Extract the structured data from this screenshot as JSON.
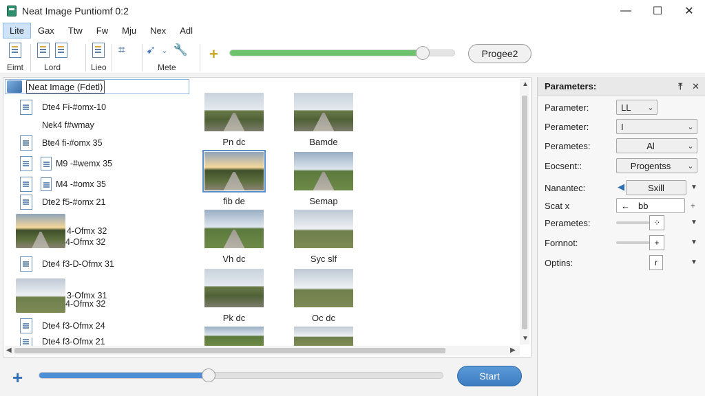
{
  "window": {
    "title": "Neat Image Puntiomf 0:2",
    "controls": [
      "—",
      "☐",
      "✕"
    ]
  },
  "menu": [
    "Lite",
    "Gax",
    "Ttw",
    "Fw",
    "Mju",
    "Nex",
    "Adl"
  ],
  "toolbar": {
    "groups": [
      {
        "label": "Eimt"
      },
      {
        "label": "Lord"
      },
      {
        "label": "Lieo"
      },
      {
        "label": "Mete"
      }
    ],
    "top_slider_fraction": 0.86,
    "progress_button": "Progee2"
  },
  "path": {
    "text": "Neat Image (Fdetl)"
  },
  "files": [
    {
      "name": "Dte4 Fi-#omx-10"
    },
    {
      "name": "Nek4 f#wmay"
    },
    {
      "name": "Bte4 fi-#omx 35"
    },
    {
      "name": "M9 -#wemx 35"
    },
    {
      "name": "M4 -#omx 35"
    },
    {
      "name": "Dte2 f5-#omx 21"
    },
    {
      "name": "4-Ofmx 32"
    },
    {
      "name": "4-Ofmx 32"
    },
    {
      "name": "Dte4 f3-D-Ofmx 31"
    },
    {
      "name": "3-Ofmx 31"
    },
    {
      "name": "4-Ofmx 32"
    },
    {
      "name": "Dte4 f3-Ofmx 24"
    },
    {
      "name": "Dte4 f3-Ofmx 21"
    }
  ],
  "thumbnails": [
    {
      "caption": "Pn dc"
    },
    {
      "caption": "Bamde"
    },
    {
      "caption": "fib de"
    },
    {
      "caption": "Semap"
    },
    {
      "caption": "Vh dc"
    },
    {
      "caption": "Syc slf"
    },
    {
      "caption": "Pk dc"
    },
    {
      "caption": "Oc dc"
    }
  ],
  "bottom": {
    "slider_fraction": 0.42,
    "start_label": "Start"
  },
  "parameters": {
    "title": "Parameters:",
    "header_icons": [
      "⤒",
      "✕"
    ],
    "rows": [
      {
        "label": "Parameter:",
        "value": "LL"
      },
      {
        "label": "Perameter:",
        "value": "I"
      },
      {
        "label": "Perametes:",
        "value": "Al"
      },
      {
        "label": "Eocsent::",
        "value": "Progentss"
      },
      {
        "label": "Nanantec:",
        "value": "Sxill"
      },
      {
        "label": "Scat x",
        "value": "bb"
      },
      {
        "label": "Perametes:",
        "value": "⁘"
      },
      {
        "label": "Fornnot:",
        "value": "+"
      },
      {
        "label": "Optins:",
        "value": "r"
      }
    ]
  }
}
